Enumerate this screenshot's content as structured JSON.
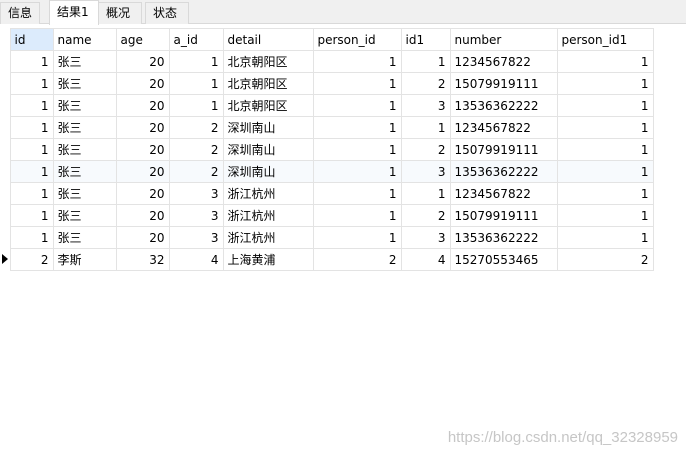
{
  "tabs": [
    {
      "label": "信息"
    },
    {
      "label": "结果1"
    },
    {
      "label": "概况"
    },
    {
      "label": "状态"
    }
  ],
  "active_tab": "结果1",
  "columns": [
    "id",
    "name",
    "age",
    "a_id",
    "detail",
    "person_id",
    "id1",
    "number",
    "person_id1"
  ],
  "rows": [
    [
      "1",
      "张三",
      "20",
      "1",
      "北京朝阳区",
      "1",
      "1",
      "1234567822",
      "1"
    ],
    [
      "1",
      "张三",
      "20",
      "1",
      "北京朝阳区",
      "1",
      "2",
      "15079919111",
      "1"
    ],
    [
      "1",
      "张三",
      "20",
      "1",
      "北京朝阳区",
      "1",
      "3",
      "13536362222",
      "1"
    ],
    [
      "1",
      "张三",
      "20",
      "2",
      "深圳南山",
      "1",
      "1",
      "1234567822",
      "1"
    ],
    [
      "1",
      "张三",
      "20",
      "2",
      "深圳南山",
      "1",
      "2",
      "15079919111",
      "1"
    ],
    [
      "1",
      "张三",
      "20",
      "2",
      "深圳南山",
      "1",
      "3",
      "13536362222",
      "1"
    ],
    [
      "1",
      "张三",
      "20",
      "3",
      "浙江杭州",
      "1",
      "1",
      "1234567822",
      "1"
    ],
    [
      "1",
      "张三",
      "20",
      "3",
      "浙江杭州",
      "1",
      "2",
      "15079919111",
      "1"
    ],
    [
      "1",
      "张三",
      "20",
      "3",
      "浙江杭州",
      "1",
      "3",
      "13536362222",
      "1"
    ],
    [
      "2",
      "李斯",
      "32",
      "4",
      "上海黄浦",
      "2",
      "4",
      "15270553465",
      "2"
    ]
  ],
  "current_row": 10,
  "selected_column": "id",
  "watermark": "https://blog.csdn.net/qq_32328959",
  "colors": {
    "selected_header": "#dcebfc",
    "alt_row": "#f7fafd",
    "grid_line": "#e3e3e3"
  }
}
